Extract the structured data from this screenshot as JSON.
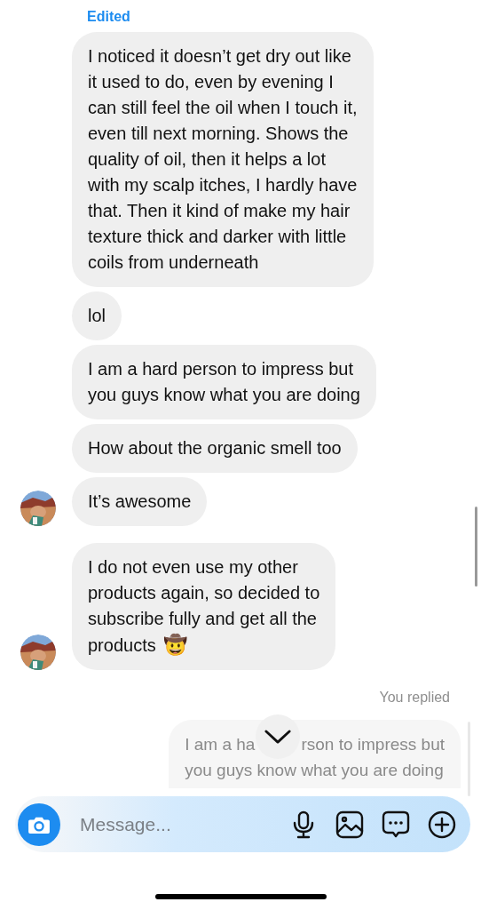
{
  "edited_label": "Edited",
  "messages": [
    {
      "spaced": false,
      "text": "I noticed it doesn’t get dry out like\nit used to do, even by evening I\ncan still feel the oil when I touch it,\neven till next morning. Shows the\nquality of oil, then it helps a lot\nwith my scalp itches, I hardly have\nthat. Then it kind of make my hair\ntexture thick and darker with little\ncoils from underneath",
      "avatar": false
    },
    {
      "spaced": false,
      "text": "lol",
      "avatar": false
    },
    {
      "spaced": false,
      "text": "I am a hard person to impress but\nyou guys know what you are doing",
      "avatar": false
    },
    {
      "spaced": false,
      "text": "How about the organic smell too",
      "avatar": false
    },
    {
      "spaced": false,
      "text": "It’s awesome",
      "avatar": true
    },
    {
      "text": "I do not even use my other\nproducts again, so decided to\nsubscribe fully and get all the\nproducts",
      "emoji": "🤠",
      "avatar": true,
      "spaced": true
    }
  ],
  "reply_label": "You replied",
  "reply": {
    "line_1_start": "I am a ha",
    "line_1_end": "rson to impress but",
    "line_2": "you guys know what you are doing"
  },
  "composer": {
    "placeholder": "Message..."
  }
}
